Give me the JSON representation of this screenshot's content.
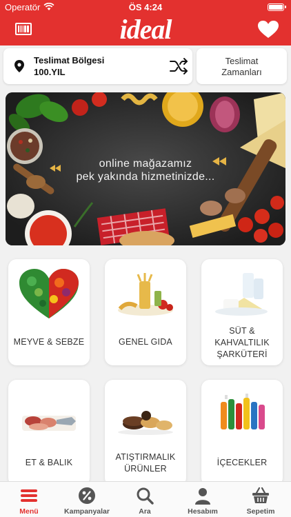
{
  "status_bar": {
    "carrier": "Operatör",
    "time": "ÖS 4:24"
  },
  "header": {
    "logo_text": "ideal",
    "barcode_icon": "barcode-icon",
    "favorites_icon": "heart-icon",
    "accent_color": "#e3312f"
  },
  "delivery": {
    "region_title": "Teslimat Bölgesi",
    "region_value": "100.YIL",
    "time_button_line1": "Teslimat",
    "time_button_line2": "Zamanları"
  },
  "banner": {
    "line1": "online mağazamız",
    "line2": "pek yakında hizmetinizde..."
  },
  "categories": [
    {
      "label_line1": "MEYVE & SEBZE",
      "label_line2": "",
      "label_line3": ""
    },
    {
      "label_line1": "GENEL GIDA",
      "label_line2": "",
      "label_line3": ""
    },
    {
      "label_line1": "SÜT &",
      "label_line2": "KAHVALTILIK",
      "label_line3": "ŞARKÜTERİ"
    },
    {
      "label_line1": "ET & BALIK",
      "label_line2": "",
      "label_line3": ""
    },
    {
      "label_line1": "ATIŞTIRMALIK",
      "label_line2": "ÜRÜNLER",
      "label_line3": ""
    },
    {
      "label_line1": "İÇECEKLER",
      "label_line2": "",
      "label_line3": ""
    }
  ],
  "tabs": [
    {
      "label": "Menü",
      "icon": "menu-icon",
      "active": true
    },
    {
      "label": "Kampanyalar",
      "icon": "percent-icon",
      "active": false
    },
    {
      "label": "Ara",
      "icon": "search-icon",
      "active": false
    },
    {
      "label": "Hesabım",
      "icon": "user-icon",
      "active": false
    },
    {
      "label": "Sepetim",
      "icon": "basket-icon",
      "active": false
    }
  ]
}
